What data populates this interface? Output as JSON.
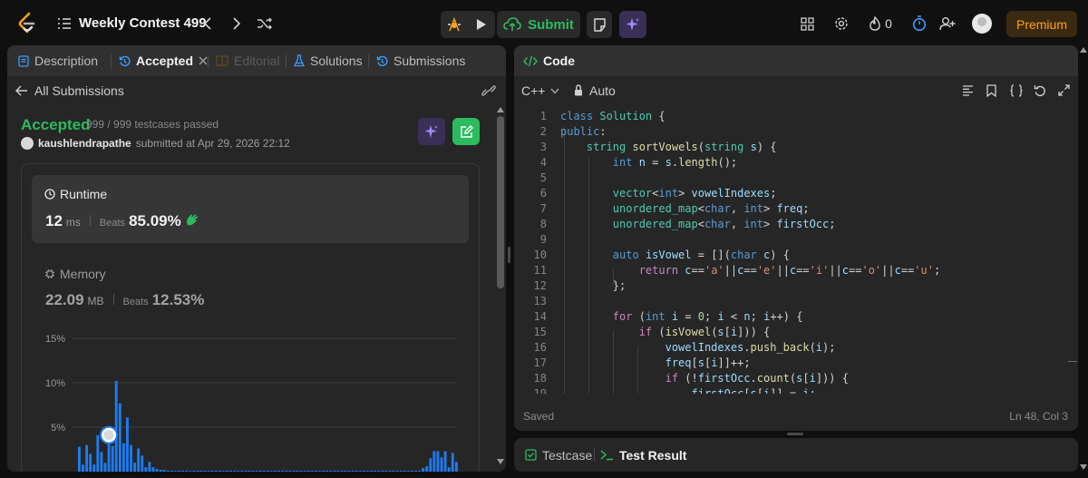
{
  "topbar": {
    "contest_title": "Weekly Contest 499",
    "submit_label": "Submit",
    "streak_count": "0",
    "premium_label": "Premium"
  },
  "left": {
    "tabs": [
      {
        "label": "Description"
      },
      {
        "label": "Accepted"
      },
      {
        "label": "Editorial"
      },
      {
        "label": "Solutions"
      },
      {
        "label": "Submissions"
      }
    ],
    "all_submissions": "All Submissions",
    "status": "Accepted",
    "testcases": "999 / 999 testcases passed",
    "username": "kaushlendrapathe",
    "submitted_at": "submitted at Apr 29, 2026 22:12",
    "runtime": {
      "label": "Runtime",
      "value": "12",
      "unit": "ms",
      "beats_label": "Beats",
      "beats_value": "85.09%"
    },
    "memory": {
      "label": "Memory",
      "value": "22.09",
      "unit": "MB",
      "beats_label": "Beats",
      "beats_value": "12.53%"
    },
    "chart_yticks": [
      "15%",
      "10%",
      "5%"
    ]
  },
  "chart_data": {
    "type": "bar",
    "ylim": [
      0,
      15
    ],
    "yticks": [
      "15%",
      "10%",
      "5%"
    ],
    "highlight_index": 8,
    "values": [
      2.8,
      0.8,
      3.0,
      2.0,
      0.8,
      4.1,
      2.2,
      1.0,
      3.1,
      2.9,
      10.2,
      7.7,
      3.2,
      6.1,
      3.0,
      1.0,
      2.6,
      1.8,
      0.5,
      1.1,
      0.5,
      0.3,
      0.2,
      0.2,
      0.1,
      0.1,
      0.1,
      0.1,
      0.1,
      0.1,
      0.1,
      0.1,
      0.1,
      0.1,
      0.1,
      0.1,
      0.1,
      0.1,
      0.1,
      0.1,
      0.1,
      0.1,
      0.1,
      0.1,
      0.1,
      0.1,
      0.1,
      0.1,
      0.1,
      0.1,
      0.1,
      0.1,
      0.1,
      0.1,
      0.1,
      0.1,
      0.1,
      0.1,
      0.1,
      0.1,
      0.1,
      0.1,
      0.1,
      0.1,
      0.1,
      0.1,
      0.1,
      0.1,
      0.1,
      0.1,
      0.1,
      0.1,
      0.1,
      0.1,
      0.1,
      0.1,
      0.1,
      0.1,
      0.1,
      0.1,
      0.1,
      0.1,
      0.1,
      0.1,
      0.1,
      0.1,
      0.1,
      0.1,
      0.1,
      0.1,
      0.1,
      0.1,
      0.1,
      0.4,
      0.6,
      1.5,
      2.3,
      2.3,
      1.6,
      2.3,
      0.5,
      2.1,
      1.1
    ]
  },
  "right": {
    "tab_label": "Code",
    "language": "C++",
    "auto_label": "Auto",
    "status_saved": "Saved",
    "cursor_pos": "Ln 48, Col 3",
    "code_lines": [
      "1",
      "2",
      "3",
      "4",
      "5",
      "6",
      "7",
      "8",
      "9",
      "10",
      "11",
      "12",
      "13",
      "14",
      "15",
      "16",
      "17",
      "18",
      "19"
    ]
  },
  "bottom": {
    "testcase_label": "Testcase",
    "test_result_label": "Test Result"
  }
}
